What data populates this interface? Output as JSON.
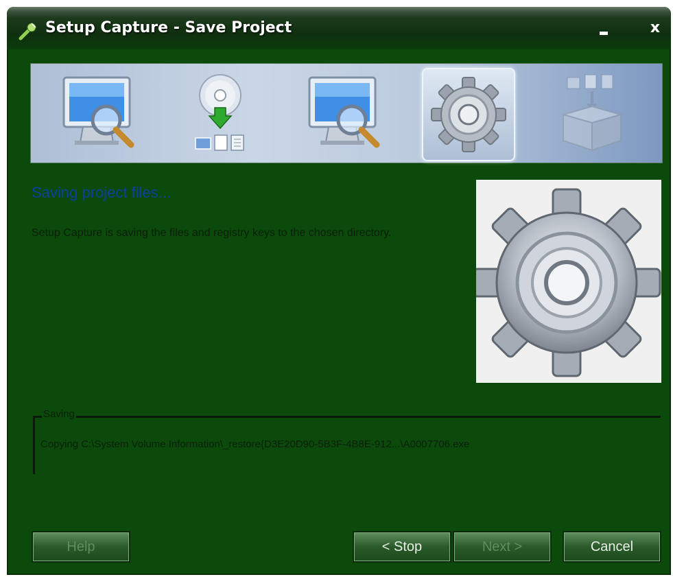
{
  "window": {
    "title": "Setup Capture - Save Project",
    "minimize_icon": "minimize-icon",
    "close_label": "x"
  },
  "steps": [
    {
      "icon": "monitor-magnifier-icon",
      "active": false
    },
    {
      "icon": "disc-download-files-icon",
      "active": false
    },
    {
      "icon": "monitor-magnifier-icon",
      "active": false
    },
    {
      "icon": "gear-icon",
      "active": true
    },
    {
      "icon": "package-box-files-icon",
      "active": false
    }
  ],
  "main": {
    "heading": "Saving project files...",
    "description": "Setup Capture is saving the files and registry keys to the chosen directory."
  },
  "progress": {
    "group_label": "Saving",
    "current_action": "Copying C:\\System Volume Information\\_restore{D3E20D90-5B3F-4B8E-912...\\A0007706.exe"
  },
  "buttons": {
    "help": "Help",
    "stop": "< Stop",
    "next": "Next >",
    "cancel": "Cancel"
  },
  "colors": {
    "window_bg": "#0b4a0b",
    "heading": "#0c3fa0",
    "banner": "#aebfd6"
  }
}
